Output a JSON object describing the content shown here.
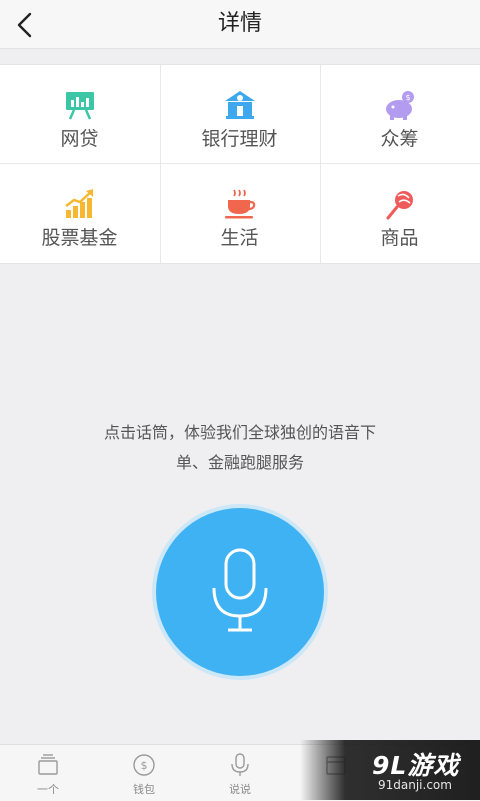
{
  "header": {
    "title": "详情",
    "back_icon": "chevron-left-icon"
  },
  "categories": [
    {
      "label": "网贷",
      "icon": "presentation-chart-icon",
      "color": "#3cc6a5"
    },
    {
      "label": "银行理财",
      "icon": "bank-icon",
      "color": "#3ea8ee"
    },
    {
      "label": "众筹",
      "icon": "piggy-bank-icon",
      "color": "#b39cf0"
    },
    {
      "label": "股票基金",
      "icon": "bar-chart-trend-icon",
      "color": "#f7b731"
    },
    {
      "label": "生活",
      "icon": "coffee-cup-icon",
      "color": "#f0674e"
    },
    {
      "label": "商品",
      "icon": "lollipop-icon",
      "color": "#ef5a5a"
    }
  ],
  "voice": {
    "prompt_line1": "点击话筒，体验我们全球独创的语音下",
    "prompt_line2": "单、金融跑腿服务",
    "mic_icon": "microphone-icon",
    "accent": "#3fb2f3"
  },
  "tabbar": {
    "tabs": [
      {
        "label": "一个",
        "icon": "card-stack-icon"
      },
      {
        "label": "钱包",
        "icon": "coin-icon"
      },
      {
        "label": "说说",
        "icon": "microphone-icon"
      },
      {
        "label": "",
        "icon": "calendar-icon"
      },
      {
        "label": "",
        "icon": "person-icon"
      }
    ]
  },
  "watermark": {
    "logo": "9L游戏",
    "url": "91danji.com"
  }
}
